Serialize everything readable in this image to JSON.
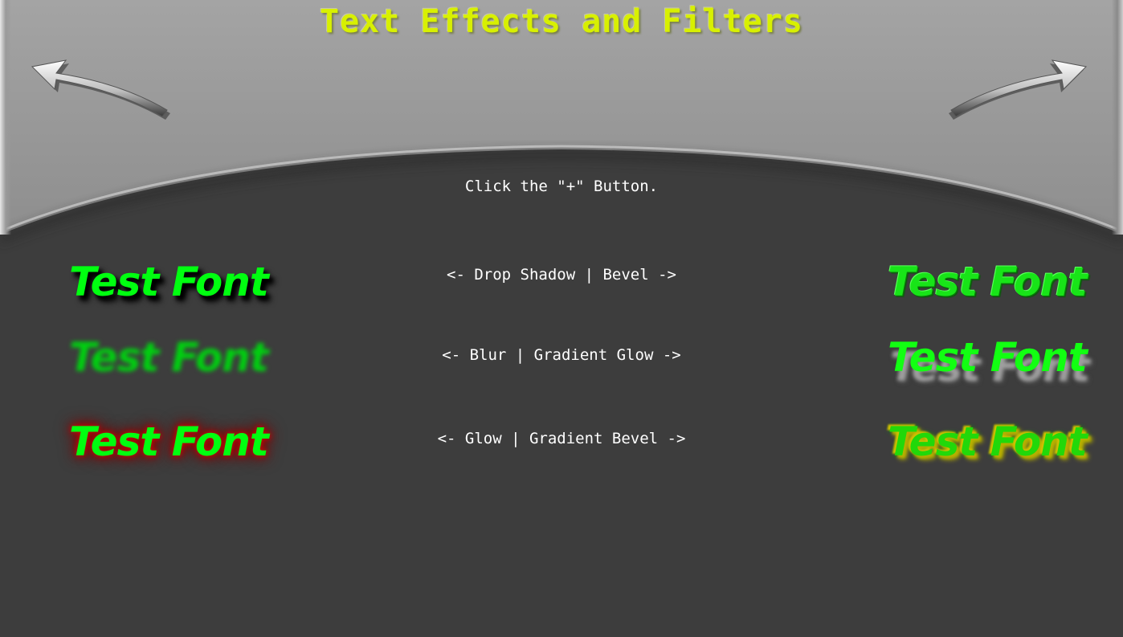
{
  "page": {
    "title": "Text Effects and Filters",
    "instruction": "Click the \"+\" Button."
  },
  "navigation": {
    "prev_icon": "curved-left-arrow-icon",
    "next_icon": "curved-right-arrow-icon"
  },
  "rows": [
    {
      "label": "<- Drop Shadow | Bevel ->",
      "left_text": "Test Font",
      "right_text": "Test Font",
      "left_effect": "Drop Shadow",
      "right_effect": "Bevel"
    },
    {
      "label": "<- Blur | Gradient Glow ->",
      "left_text": "Test Font",
      "right_text": "Test Font",
      "left_effect": "Blur",
      "right_effect": "Gradient Glow"
    },
    {
      "label": "<- Glow | Gradient Bevel ->",
      "left_text": "Test Font",
      "right_text": "Test Font",
      "left_effect": "Glow",
      "right_effect": "Gradient Bevel"
    }
  ],
  "colors": {
    "title": "#d8f000",
    "sample_text": "#00ff10",
    "header_panel": "#9a9a9a",
    "background": "#3d3d3d",
    "glow": "#c01010",
    "gradient_bevel": "#d0c000"
  }
}
